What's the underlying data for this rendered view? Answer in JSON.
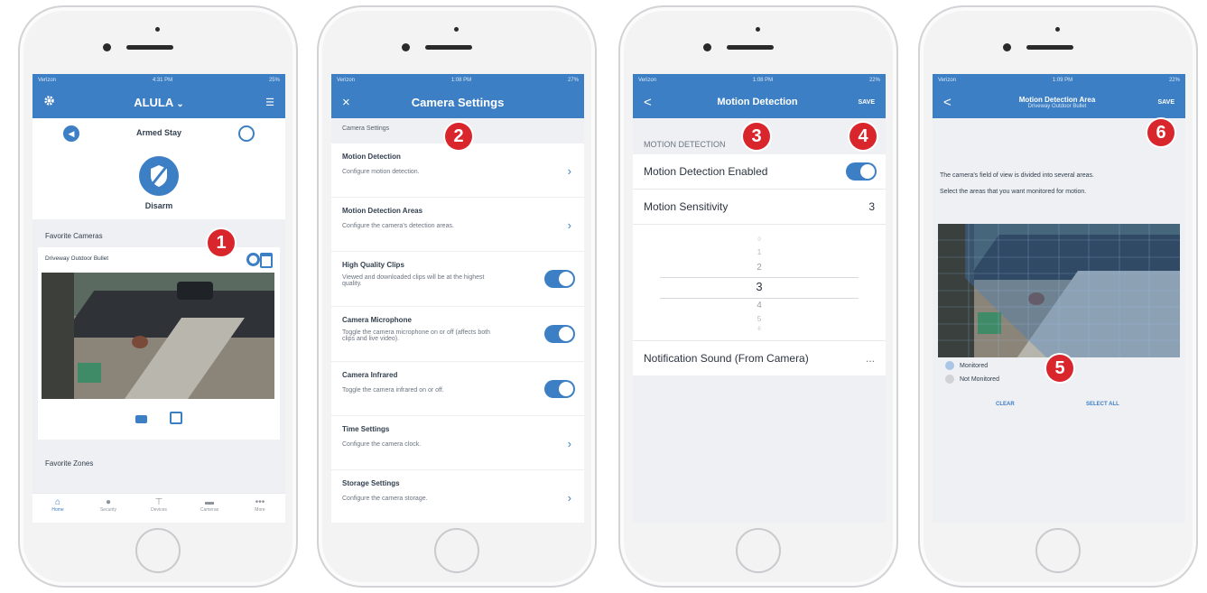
{
  "colors": {
    "primary": "#3d7fc4",
    "badge": "#d9262c"
  },
  "badges": [
    "1",
    "2",
    "3",
    "4",
    "5",
    "6"
  ],
  "p1": {
    "status": {
      "carrier": "Verizon",
      "time": "4:31 PM",
      "battery": "25%"
    },
    "nav": {
      "settings_icon": "gear-icon",
      "title": "ALULA",
      "chevron": "⌄",
      "right_icon": "filter-icon"
    },
    "mode": {
      "left_icon": "speaker-icon",
      "label": "Armed Stay",
      "right_icon": "clock-icon"
    },
    "disarm": {
      "icon": "shield-slash-icon",
      "label": "Disarm"
    },
    "fav_cameras_heading": "Favorite Cameras",
    "camera_name": "Driveway Outdoor Bullet",
    "fav_zones_heading": "Favorite Zones",
    "tabs": [
      {
        "label": "Home",
        "icon": "home-icon"
      },
      {
        "label": "Security",
        "icon": "security-icon"
      },
      {
        "label": "Devices",
        "icon": "devices-icon"
      },
      {
        "label": "Cameras",
        "icon": "camera-icon"
      },
      {
        "label": "More",
        "icon": "more-icon"
      }
    ]
  },
  "p2": {
    "status": {
      "carrier": "Verizon",
      "time": "1:08 PM",
      "battery": "27%"
    },
    "nav": {
      "close": "×",
      "title": "Camera Settings"
    },
    "section": "Camera Settings",
    "rows": [
      {
        "title": "Motion Detection",
        "desc": "Configure motion detection.",
        "control": "chevron"
      },
      {
        "title": "Motion Detection Areas",
        "desc": "Configure the camera's detection areas.",
        "control": "chevron"
      },
      {
        "title": "High Quality Clips",
        "desc": "Viewed and downloaded clips will be at the highest quality.",
        "control": "toggle",
        "on": true
      },
      {
        "title": "Camera Microphone",
        "desc": "Toggle the camera microphone on or off (affects both clips and live video).",
        "control": "toggle",
        "on": true
      },
      {
        "title": "Camera Infrared",
        "desc": "Toggle the camera infrared on or off.",
        "control": "toggle",
        "on": true
      },
      {
        "title": "Time Settings",
        "desc": "Configure the camera clock.",
        "control": "chevron"
      },
      {
        "title": "Storage Settings",
        "desc": "Configure the camera storage.",
        "control": "chevron"
      }
    ]
  },
  "p3": {
    "status": {
      "carrier": "Verizon",
      "time": "1:08 PM",
      "battery": "22%"
    },
    "nav": {
      "back": "<",
      "title": "Motion Detection",
      "save": "SAVE"
    },
    "section": "MOTION DETECTION",
    "enabled_label": "Motion Detection Enabled",
    "sensitivity_label": "Motion Sensitivity",
    "sensitivity_value": "3",
    "picker": [
      "0",
      "1",
      "2",
      "3",
      "4",
      "5",
      "6"
    ],
    "notification_label": "Notification Sound (From Camera)",
    "notification_value": "..."
  },
  "p4": {
    "status": {
      "carrier": "Verizon",
      "time": "1:09 PM",
      "battery": "22%"
    },
    "nav": {
      "back": "<",
      "title": "Motion Detection Area",
      "subtitle": "Driveway Outdoor Bullet",
      "save": "SAVE"
    },
    "text1": "The camera's field of view is divided into several areas.",
    "text2": "Select the areas that you want monitored for motion.",
    "legend_monitored": "Monitored",
    "legend_not_monitored": "Not Monitored",
    "clear": "CLEAR",
    "select_all": "SELECT ALL"
  }
}
